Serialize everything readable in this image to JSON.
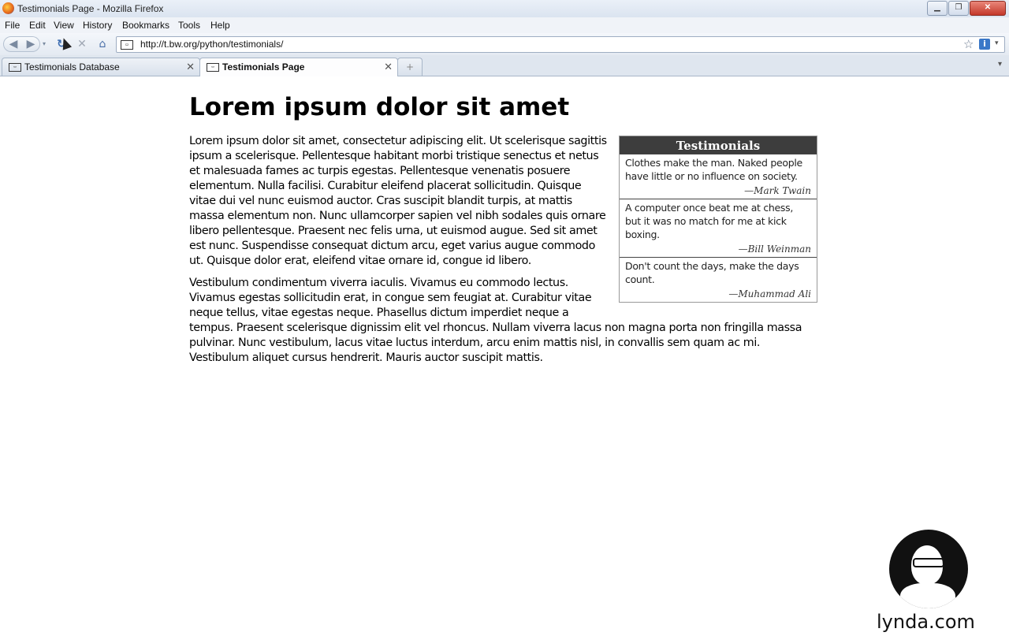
{
  "window": {
    "title": "Testimonials Page - Mozilla Firefox",
    "minimize": "▁",
    "maximize": "❐",
    "close": "✕"
  },
  "menu": [
    "File",
    "Edit",
    "View",
    "History",
    "Bookmarks",
    "Tools",
    "Help"
  ],
  "nav": {
    "back": "◀",
    "forward": "▶",
    "dropdown": "▾",
    "reload": "↻",
    "stop": "✕",
    "home": "⌂",
    "url": "http://t.bw.org/python/testimonials/",
    "star": "☆",
    "info": "i",
    "url_dropdown": "▾"
  },
  "tabs": [
    {
      "label": "Testimonials Database",
      "active": false
    },
    {
      "label": "Testimonials Page",
      "active": true
    }
  ],
  "tab_close": "✕",
  "tab_new": "+",
  "page": {
    "heading": "Lorem ipsum dolor sit amet",
    "paragraphs": [
      "Lorem ipsum dolor sit amet, consectetur adipiscing elit. Ut scelerisque sagittis ipsum a scelerisque. Pellentesque habitant morbi tristique senectus et netus et malesuada fames ac turpis egestas. Pellentesque venenatis posuere elementum. Nulla facilisi. Curabitur eleifend placerat sollicitudin. Quisque vitae dui vel nunc euismod auctor. Cras suscipit blandit turpis, at mattis massa elementum non. Nunc ullamcorper sapien vel nibh sodales quis ornare libero pellentesque. Praesent nec felis urna, ut euismod augue. Sed sit amet est nunc. Suspendisse consequat dictum arcu, eget varius augue commodo ut. Quisque dolor erat, eleifend vitae ornare id, congue id libero.",
      "Vestibulum condimentum viverra iaculis. Vivamus eu commodo lectus. Vivamus egestas sollicitudin erat, in congue sem feugiat at. Curabitur vitae neque tellus, vitae egestas neque. Phasellus dictum imperdiet neque a tempus. Praesent scelerisque dignissim elit vel rhoncus. Nullam viverra lacus non magna porta non fringilla massa pulvinar. Nunc vestibulum, lacus vitae luctus interdum, arcu enim mattis nisl, in convallis sem quam ac mi. Vestibulum aliquet cursus hendrerit. Mauris auctor suscipit mattis."
    ]
  },
  "testimonials": {
    "title": "Testimonials",
    "items": [
      {
        "text": "Clothes make the man. Naked people have little or no influence on society.",
        "author": "—Mark Twain"
      },
      {
        "text": "A computer once beat me at chess, but it was no match for me at kick boxing.",
        "author": "—Bill Weinman"
      },
      {
        "text": "Don't count the days, make the days count.",
        "author": "—Muhammad Ali"
      }
    ]
  },
  "logo": {
    "text": "lynda.com"
  },
  "colors": {
    "sidebar_header_bg": "#3d3d3d",
    "sidebar_header_fg": "#ffffff"
  }
}
